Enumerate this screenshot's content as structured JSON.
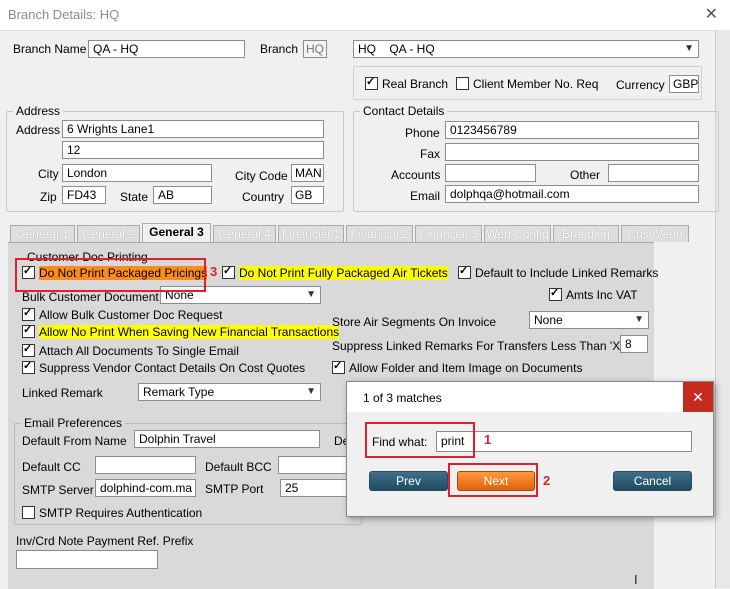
{
  "window": {
    "title": "Branch Details: HQ",
    "close_glyph": "✕"
  },
  "branch": {
    "name_label": "Branch Name",
    "name_value": "QA - HQ",
    "branch_label": "Branch",
    "branch_code": "HQ",
    "selector_value": "HQ    QA - HQ"
  },
  "flags": {
    "real_branch_label": "Real Branch",
    "real_branch": true,
    "client_member_label": "Client Member No. Req",
    "client_member": false,
    "currency_label": "Currency",
    "currency_value": "GBP"
  },
  "address": {
    "caption": "Address",
    "address_label": "Address",
    "line1": "6 Wrights Lane1",
    "line2": "12",
    "city_label": "City",
    "city": "London",
    "city_code_label": "City Code",
    "city_code": "MAN",
    "zip_label": "Zip",
    "zip": "FD43",
    "state_label": "State",
    "state": "AB",
    "country_label": "Country",
    "country": "GB"
  },
  "contact": {
    "caption": "Contact Details",
    "phone_label": "Phone",
    "phone": "0123456789",
    "fax_label": "Fax",
    "fax": "",
    "accounts_label": "Accounts",
    "accounts": "",
    "other_label": "Other",
    "other": "",
    "email_label": "Email",
    "email": "dolphqa@hotmail.com"
  },
  "tabs": [
    {
      "label": "General 1"
    },
    {
      "label": "General 2"
    },
    {
      "label": "General 3"
    },
    {
      "label": "General 4"
    },
    {
      "label": "Financial 1"
    },
    {
      "label": "Financial 2"
    },
    {
      "label": "Financial 3"
    },
    {
      "label": "Web Config"
    },
    {
      "label": "Branding"
    },
    {
      "label": "Cust/Vend"
    }
  ],
  "general3": {
    "doc_printing_caption": "Customer Doc Printing",
    "no_print_packaged": "Do Not Print Packaged Pricings",
    "no_print_air": "Do Not Print Fully Packaged Air Tickets",
    "default_linked_remarks": "Default to Include Linked Remarks",
    "bulk_customer_doc_label": "Bulk Customer Document",
    "bulk_customer_doc_value": "None",
    "amts_inc_vat": "Amts Inc VAT",
    "allow_bulk": "Allow Bulk Customer Doc Request",
    "allow_no_print": "Allow No Print When Saving New Financial Transactions",
    "store_air_label": "Store Air Segments On Invoice",
    "store_air_value": "None",
    "attach_all": "Attach All Documents To Single Email",
    "suppress_linked_label": "Suppress Linked Remarks For Transfers Less Than 'X'",
    "suppress_linked_value": "8",
    "suppress_vendor": "Suppress Vendor Contact Details On Cost Quotes",
    "allow_folder_image": "Allow Folder and Item Image on Documents",
    "linked_remark_label": "Linked Remark",
    "linked_remark_value": "Remark Type",
    "email_caption": "Email Preferences",
    "default_from_label": "Default From Name",
    "default_from_value": "Dolphin Travel",
    "de_cut": "De",
    "default_cc_label": "Default CC",
    "default_bcc_label": "Default BCC",
    "smtp_server_label": "SMTP Server",
    "smtp_server_value": "dolphind-com.ma",
    "smtp_port_label": "SMTP Port",
    "smtp_port_value": "25",
    "smtp_auth": "SMTP Requires Authentication",
    "inv_prefix_label": "Inv/Crd Note Payment Ref. Prefix"
  },
  "find_dialog": {
    "title": "1 of 3 matches",
    "close_glyph": "✕",
    "find_label": "Find what:",
    "find_value": "print",
    "prev_label": "Prev",
    "next_label": "Next",
    "cancel_label": "Cancel"
  },
  "annotations": {
    "n1": "1",
    "n2": "2",
    "n3": "3"
  },
  "colors": {
    "highlight_yellow": "#ffff00",
    "highlight_orange": "#ff8c1a",
    "annotation_red": "#e0202a",
    "button_blue": "#1f4b63",
    "button_orange": "#e0600a"
  }
}
